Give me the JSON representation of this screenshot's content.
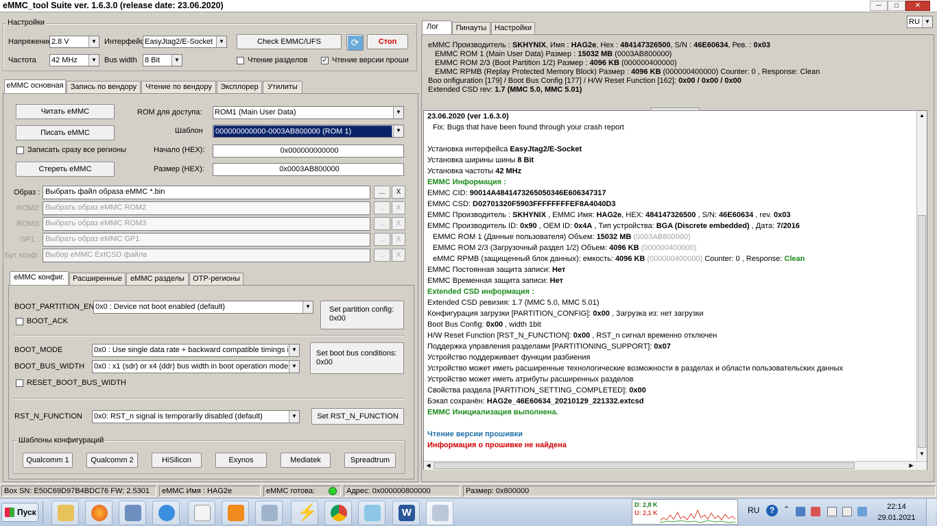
{
  "window": {
    "title": "eMMC_tool Suite  ver. 1.6.3.0 (release date: 23.06.2020)",
    "minimize": "─",
    "maximize": "□",
    "close": "✕"
  },
  "settings": {
    "group_label": "Настройки",
    "voltage_label": "Напряжение",
    "voltage_value": "2.8 V",
    "interface_label": "Интерфейс",
    "interface_value": "EasyJtag2/E-Socket",
    "freq_label": "Частота",
    "freq_value": "42 MHz",
    "bus_label": "Bus width",
    "bus_value": "8 Bit",
    "check_button": "Check EMMC/UFS",
    "stop_button": "Стоп",
    "read_parts_label": "Чтение разделов",
    "read_parts_checked": "",
    "read_fw_label": "Чтение версии проши",
    "read_fw_checked": "✓",
    "lang": "RU"
  },
  "main_tabs": [
    "eMMC основная",
    "Запись по вендору",
    "Чтение по вендору",
    "Эксплорер",
    "Утилиты"
  ],
  "main": {
    "read_button": "Читать eMMC",
    "write_button": "Писать eMMC",
    "erase_button": "Стереть eMMC",
    "write_all_label": "Записать сразу все регионы",
    "rom_label": "ROM для доступа:",
    "rom_value": "ROM1 (Main User Data)",
    "template_label": "Шаблон",
    "template_value": "000000000000-0003AB800000 (ROM 1)",
    "start_label": "Начало (HEX):",
    "start_value": "0x000000000000",
    "size_label": "Размер (HEX):",
    "size_value": "0x0003AB800000",
    "images": [
      {
        "label": "Образ :",
        "value": "Выбрать файл образа eMMC *.bin"
      },
      {
        "label": "ROM2:",
        "value": "Выбрать образ eMMC ROM2"
      },
      {
        "label": "ROM3:",
        "value": "Выбрать образ eMMC ROM3"
      },
      {
        "label": "GP1 :",
        "value": "Выбрать образ eMMC GP1"
      },
      {
        "label": "Бут конф:",
        "value": "Выбор eMMC ExtCSD файла"
      }
    ],
    "browse": "...",
    "clear": "X"
  },
  "sub_tabs": [
    "eMMC конфиг.",
    "Расширенные",
    "eMMC разделы",
    "OTP-регионы"
  ],
  "config": {
    "boot_partition_label": "BOOT_PARTITION_EN",
    "boot_partition_value": "0x0 : Device not boot enabled (default)",
    "boot_ack_label": "BOOT_ACK",
    "set_partition_button_1": "Set partition config:",
    "set_partition_button_2": "0x00",
    "boot_mode_label": "BOOT_MODE",
    "boot_mode_value": "0x0 : Use single data rate + backward compatible timings in",
    "boot_bus_label": "BOOT_BUS_WIDTH",
    "boot_bus_value": "0x0 : x1 (sdr) or x4 (ddr) bus width in boot operation mode",
    "set_boot_bus_button_1": "Set boot bus conditions:",
    "set_boot_bus_button_2": "0x00",
    "reset_boot_bus_label": "RESET_BOOT_BUS_WIDTH",
    "rst_label": "RST_N_FUNCTION",
    "rst_value": "0x0: RST_n signal is temporarily disabled (default)",
    "set_rst_button": "Set RST_N_FUNCTION",
    "templates_label": "Шаблоны конфигураций",
    "templates": [
      "Qualcomm 1",
      "Qualcomm 2",
      "HiSilicon",
      "Exynos",
      "Mediatek",
      "Spreadtrum"
    ]
  },
  "right_tabs": [
    "Лог",
    "Пинауты",
    "Настройки"
  ],
  "info": {
    "l1_a": "eMMC Производитель :",
    "l1_b": "SKHYNIX",
    "l1_c": ", Имя :",
    "l1_d": "HAG2e",
    "l1_e": ", Hex :",
    "l1_f": "484147326500",
    "l1_g": ", S/N :",
    "l1_h": "46E60634",
    "l1_i": ", Рев. :",
    "l1_j": "0x03",
    "l2_a": "EMMC ROM 1 (Main User Data) Размер :",
    "l2_b": "15032 MB",
    "l2_c": "(0003AB800000)",
    "l3_a": "EMMC ROM 2/3 (Boot Partition 1/2) Размер :",
    "l3_b": "4096 KB",
    "l3_c": "(000000400000)",
    "l4_a": "EMMC RPMB (Replay Protected Memory Block) Размер :",
    "l4_b": "4096 KB",
    "l4_c": "(000000400000) Counter: 0 , Response: Clean",
    "l5_a": "Boo  onfiguration [179] / Boot Bus Config [177] / H/W Reset Function [162]:",
    "l5_b": "0x00 / 0x00 / 0x00",
    "l6_a": "Extended CSD rev:",
    "l6_b": "1.7 (MMC 5.0, MMC 5.01)"
  },
  "log": {
    "date_line": "23.06.2020 (ver 1.6.3.0)",
    "fix_line": "Fix:  Bugs that have been found through your crash report",
    "iface_a": "Установка интерфейса",
    "iface_b": "EasyJtag2/E-Socket",
    "bus_a": "Установка ширины шины",
    "bus_b": "8 Bit",
    "freq_a": "Установка частоты",
    "freq_b": "42 MHz",
    "info_title": "EMMC Информация :",
    "cid_a": "EMMC CID:",
    "cid_b": "90014A4841473265050346E606347317",
    "csd_a": "EMMC CSD:",
    "csd_b": "D02701320F5903FFFFFFFFEF8A4040D3",
    "manuf_a": "EMMC Производитель :",
    "manuf_b": "SKHYNIX",
    "manuf_c": ", EMMC Имя:",
    "manuf_d": "HAG2e",
    "manuf_e": ", HEX:",
    "manuf_f": "484147326500",
    "manuf_g": ", S/N:",
    "manuf_h": "46E60634",
    "manuf_i": ", rev.",
    "manuf_j": "0x03",
    "mid_a": "EMMC Производитель ID:",
    "mid_b": "0x90",
    "mid_c": ", OEM ID:",
    "mid_d": "0x4A",
    "mid_e": ", Тип устройства:",
    "mid_f": "BGA (Discrete embedded)",
    "mid_g": ", Дата:",
    "mid_h": "7/2016",
    "rom1_a": "EMMC ROM 1 (Данные пользователя) Объем:",
    "rom1_b": "15032 MB",
    "rom1_c": "(0003AB800000)",
    "rom23_a": "EMMC ROM 2/3 (Загрузочный раздел 1/2) Объем:",
    "rom23_b": "4096 KB",
    "rom23_c": "(000000400000)",
    "rpmb_a": "eMMC RPMB (защищенный блок данных): емкость:",
    "rpmb_b": "4096 KB",
    "rpmb_c": "(000000400000)",
    "rpmb_d": "Counter: 0 , Response:",
    "rpmb_e": "Clean",
    "perm_a": "EMMC Постоянная защита записи:",
    "perm_b": "Нет",
    "temp_a": "EMMC Временная защита записи:",
    "temp_b": "Нет",
    "ext_title": "Extended CSD информация :",
    "extrev": "Extended CSD ревизия: 1.7 (MMC 5.0, MMC 5.01)",
    "pc_a": "Конфигурация загрузки [PARTITION_CONFIG]:",
    "pc_b": "0x00",
    "pc_c": ", Загрузка из: нет загрузки",
    "bbc_a": "Boot Bus Config:",
    "bbc_b": "0x00",
    "bbc_c": ", width 1bit",
    "hw_a": "H/W Reset Function [RST_N_FUNCTION]:",
    "hw_b": "0x00",
    "hw_c": ", RST_n сигнал временно отключен",
    "ps_a": "Поддержка управления разделами [PARTITIONING_SUPPORT]:",
    "ps_b": "0x07",
    "f1": "Устройство поддерживает функции разбиения",
    "f2": "Устройство может иметь расширенные технологические возможности в разделах и области пользовательских данных",
    "f3": "Устройство может иметь атрибуты расширенных разделов",
    "psc_a": "Свойства раздела [PARTITION_SETTING_COMPLETED]:",
    "psc_b": "0x00",
    "bk_a": "Бэкап сохранён:",
    "bk_b": "HAG2e_46E60634_20210129_221332.extcsd",
    "init_done": "EMMC Инициализация выполнена.",
    "fw_read": "Чтение версии прошивки",
    "fw_nf": "Информация о прошивке не найдена",
    "splitter": "....."
  },
  "status": {
    "box_sn": "Box SN:  E50C69D97B4BDC76  FW:  2.5301",
    "emmc_name": "eMMC Имя : HAG2e",
    "emmc_ready": "eMMC готова:",
    "address": "Адрес: 0x000000800000",
    "size": "Размер: 0x800000"
  },
  "taskbar": {
    "start": "Пуск",
    "lang": "RU",
    "help": "?",
    "net_d": "D: 2,8 K",
    "net_u": "U: 2,1 K",
    "time": "22:14",
    "date": "29.01.2021",
    "w_letter": "W"
  },
  "colors": {
    "stop_text": "#d40000",
    "log_green": "#1a8a1a",
    "log_blue": "#1e6ea6",
    "log_red": "#d40000",
    "led": "#2fd12f"
  }
}
